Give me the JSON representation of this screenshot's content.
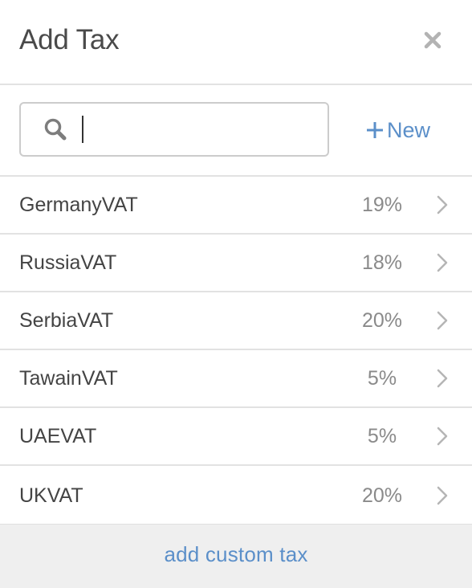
{
  "header": {
    "title": "Add Tax",
    "close_icon": "close-icon"
  },
  "search": {
    "value": "",
    "placeholder": "",
    "icon": "search-icon"
  },
  "new_button": {
    "icon": "plus-icon",
    "label": "New"
  },
  "taxes": [
    {
      "name": "GermanyVAT",
      "rate": "19%"
    },
    {
      "name": "RussiaVAT",
      "rate": "18%"
    },
    {
      "name": "SerbiaVAT",
      "rate": "20%"
    },
    {
      "name": "TawainVAT",
      "rate": "5%"
    },
    {
      "name": "UAEVAT",
      "rate": "5%"
    },
    {
      "name": "UKVAT",
      "rate": "20%"
    }
  ],
  "footer": {
    "link_label": "add custom tax"
  },
  "colors": {
    "accent": "#5b8fc9",
    "text": "#444444",
    "muted": "#8a8a8a",
    "divider": "#e2e2e2",
    "footer_bg": "#efefef"
  }
}
